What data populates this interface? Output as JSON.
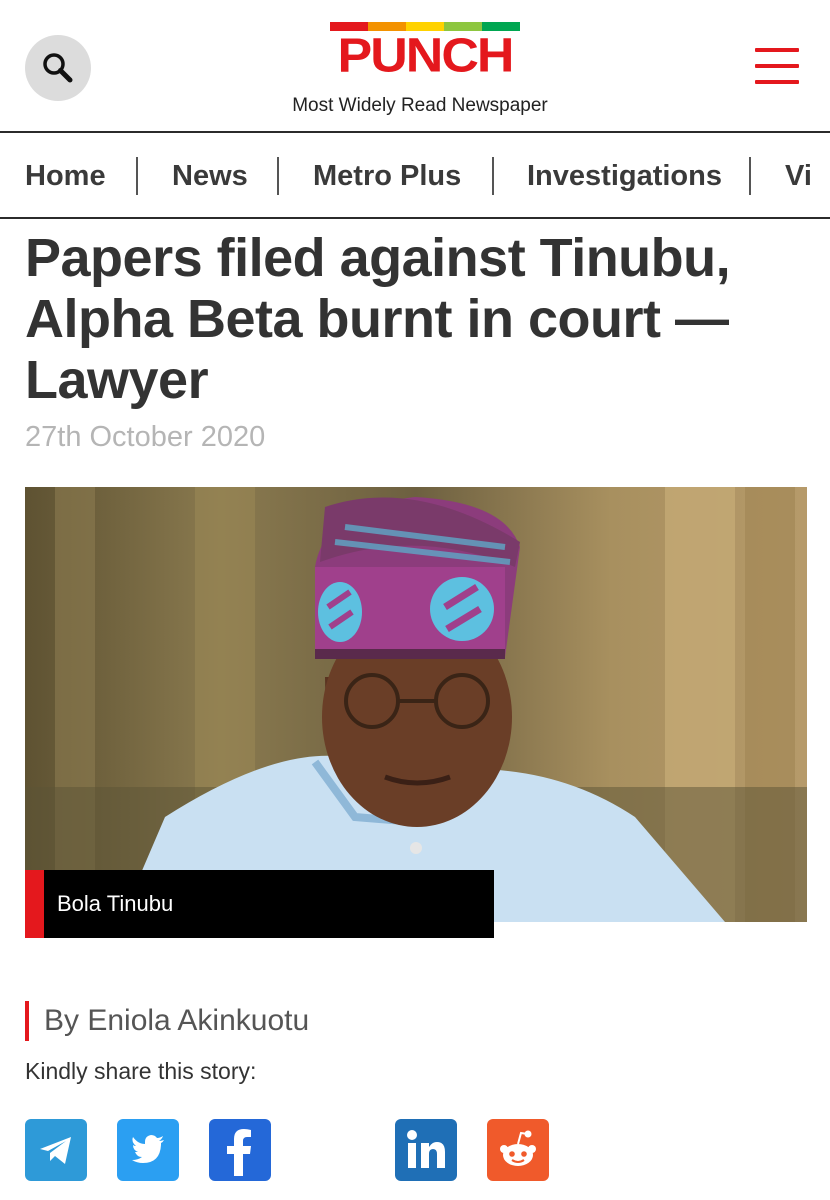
{
  "header": {
    "logo_text": "PUNCH",
    "tagline": "Most Widely Read Newspaper",
    "logo_bar_colors": [
      "#e4181d",
      "#f39200",
      "#ffd200",
      "#8dc63f",
      "#00a651"
    ],
    "search_icon": "search-icon",
    "menu_icon": "hamburger-menu-icon"
  },
  "nav": {
    "items": [
      {
        "label": "Home"
      },
      {
        "label": "News"
      },
      {
        "label": "Metro Plus"
      },
      {
        "label": "Investigations"
      },
      {
        "label": "Vi"
      }
    ]
  },
  "article": {
    "headline": "Papers filed against Tinubu, Alpha Beta burnt in court — Lawyer",
    "date": "27th October 2020",
    "image_caption": "Bola Tinubu",
    "byline": "By Eniola Akinkuotu",
    "share_label": "Kindly share this story:"
  },
  "share": {
    "buttons": [
      {
        "icon": "telegram-icon",
        "color": "#2e9ad8"
      },
      {
        "icon": "twitter-icon",
        "color": "#2b9ff2"
      },
      {
        "icon": "facebook-icon",
        "color": "#2468d8"
      },
      {
        "icon": "linkedin-icon",
        "color": "#1f6fb6"
      },
      {
        "icon": "reddit-icon",
        "color": "#f05a2b"
      }
    ]
  },
  "colors": {
    "brand_red": "#e4181d",
    "text_dark": "#333333",
    "date_gray": "#b5b5b5"
  }
}
